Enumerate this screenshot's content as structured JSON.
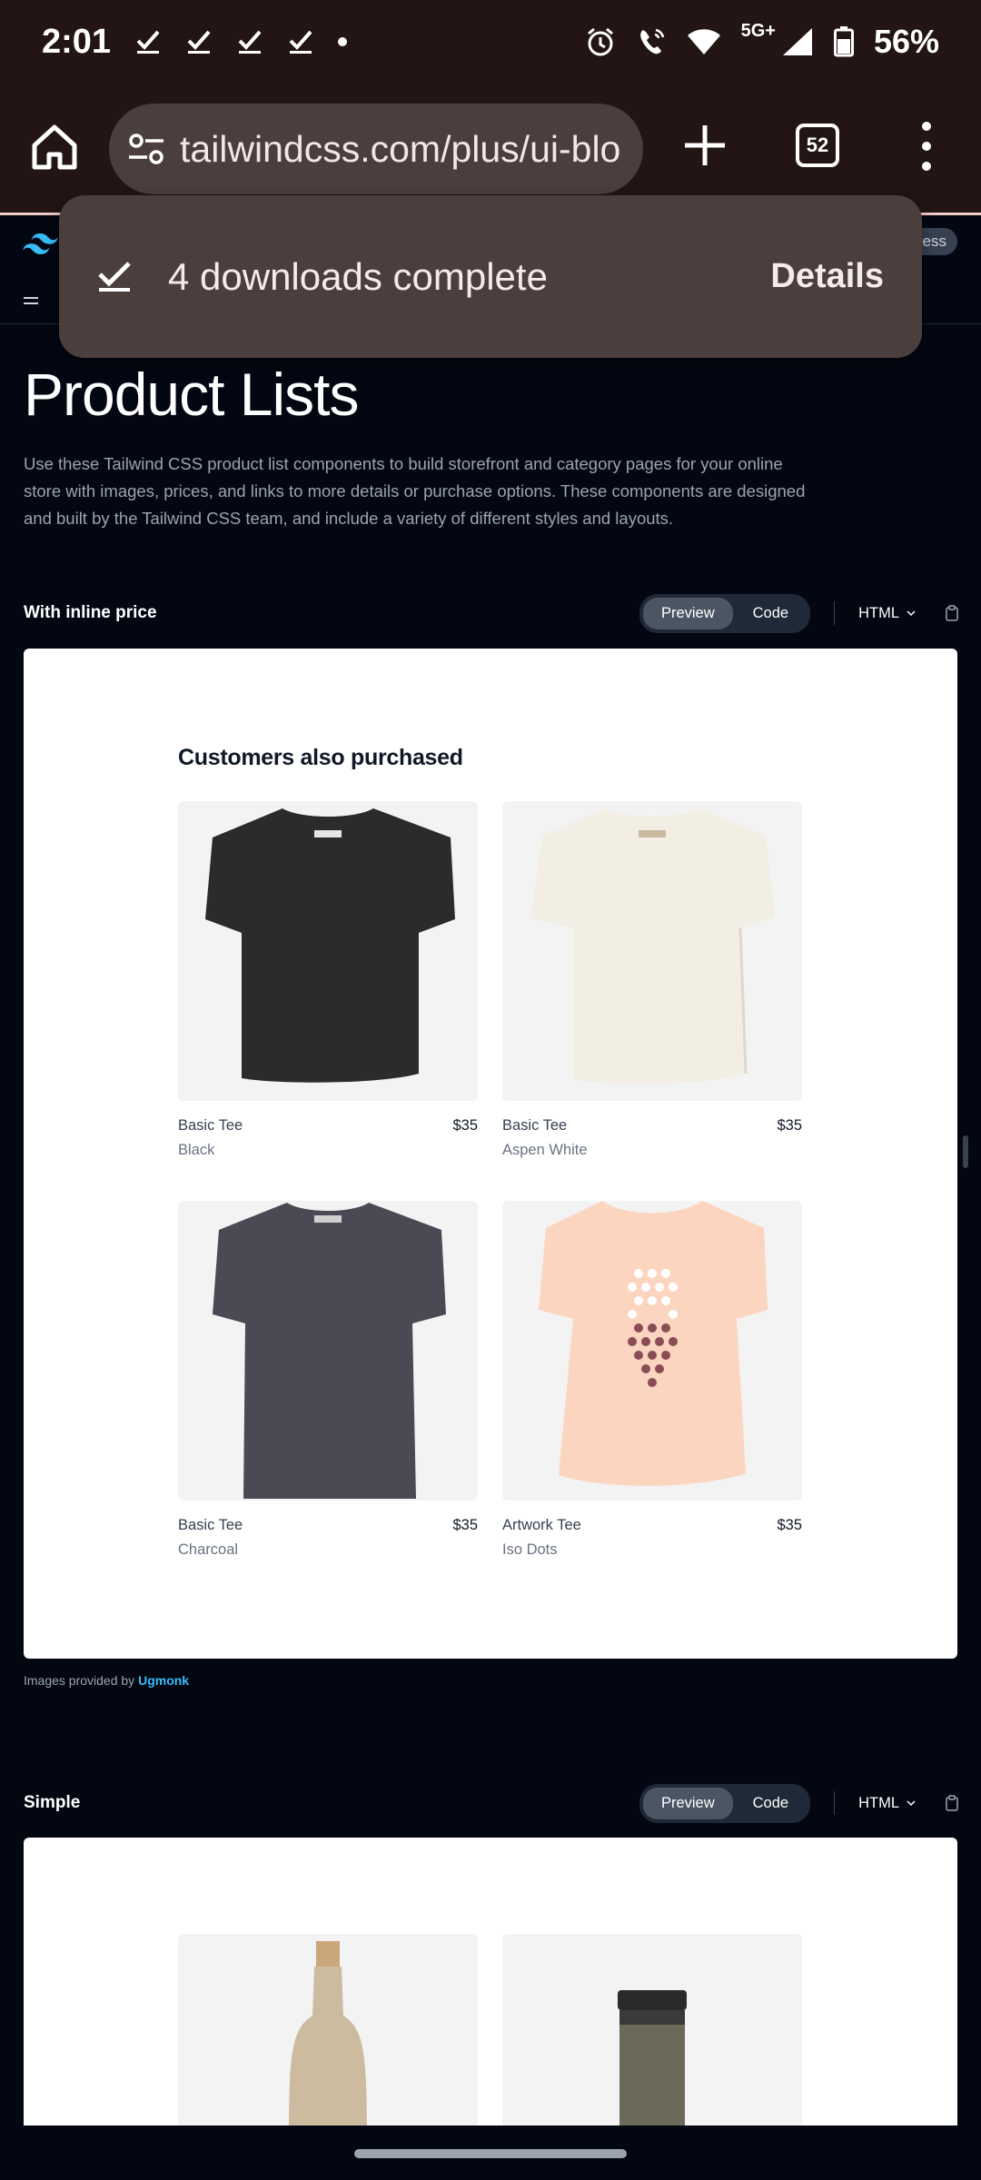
{
  "status_bar": {
    "time": "2:01",
    "network": "5G+",
    "battery": "56%"
  },
  "browser": {
    "url": "tailwindcss.com/plus/ui-blo",
    "tab_count": "52"
  },
  "snackbar": {
    "message": "4 downloads complete",
    "action": "Details"
  },
  "site_nav": {
    "access_pill": "ess"
  },
  "page": {
    "title": "Product Lists",
    "intro": "Use these Tailwind CSS product list components to build storefront and category pages for your online store with images, prices, and links to more details or purchase options. These components are designed and built by the Tailwind CSS team, and include a variety of different styles and layouts."
  },
  "sections": [
    {
      "name": "With inline price",
      "tabs": [
        "Preview",
        "Code"
      ],
      "language": "HTML",
      "preview": {
        "heading": "Customers also purchased",
        "products": [
          {
            "name": "Basic Tee",
            "price": "$35",
            "color": "Black"
          },
          {
            "name": "Basic Tee",
            "price": "$35",
            "color": "Aspen White"
          },
          {
            "name": "Basic Tee",
            "price": "$35",
            "color": "Charcoal"
          },
          {
            "name": "Artwork Tee",
            "price": "$35",
            "color": "Iso Dots"
          }
        ]
      },
      "credit_prefix": "Images provided by ",
      "credit_link": "Ugmonk"
    },
    {
      "name": "Simple",
      "tabs": [
        "Preview",
        "Code"
      ],
      "language": "HTML"
    }
  ]
}
